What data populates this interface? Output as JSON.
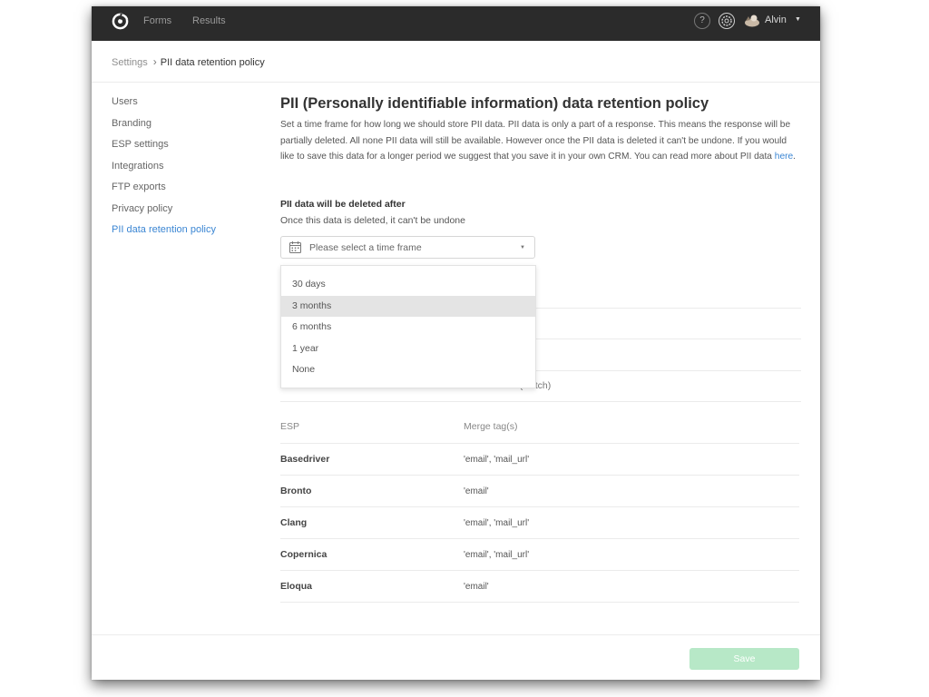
{
  "topbar": {
    "nav": [
      {
        "label": "Forms"
      },
      {
        "label": "Results"
      }
    ],
    "help_label": "?",
    "user_name": "Alvin",
    "user_caret": "▼"
  },
  "breadcrumb": {
    "parent": "Settings",
    "separator": "›",
    "current": "PII data retention policy"
  },
  "sidebar": {
    "items": [
      {
        "label": "Users"
      },
      {
        "label": "Branding"
      },
      {
        "label": "ESP settings"
      },
      {
        "label": "Integrations"
      },
      {
        "label": "FTP exports"
      },
      {
        "label": "Privacy policy"
      },
      {
        "label": "PII data retention policy",
        "active": true
      }
    ]
  },
  "main": {
    "title": "PII (Personally identifiable information) data retention policy",
    "description": "Set a time frame for how long we should store PII data. PII data is only a part of a response. This means the response will be partially deleted. All none PII data will still be available. However once the PII data is deleted it can't be undone. If you would like to save this data for a longer period we suggest that you save it in your own CRM. You can read more about PII data ",
    "description_link": "here",
    "description_end": ".",
    "section_label": "PII data will be deleted after",
    "section_sub": "Once this data is deleted, it can't be undone",
    "select": {
      "placeholder": "Please select a time frame",
      "caret": "▼",
      "options": [
        "30 days",
        "3 months",
        "6 months",
        "1 year",
        "None"
      ],
      "highlighted_index": 1
    },
    "partial_row_text": "Postal code (Dutch)"
  },
  "esp_table": {
    "headers": [
      "ESP",
      "Merge tag(s)"
    ],
    "rows": [
      {
        "esp": "Basedriver",
        "tags": "'email', 'mail_url'"
      },
      {
        "esp": "Bronto",
        "tags": "'email'"
      },
      {
        "esp": "Clang",
        "tags": "'email', 'mail_url'"
      },
      {
        "esp": "Copernica",
        "tags": "'email', 'mail_url'"
      },
      {
        "esp": "Eloqua",
        "tags": "'email'"
      }
    ]
  },
  "footer": {
    "save_label": "Save"
  },
  "colors": {
    "topbar": "#2b2b2b",
    "link": "#3b86d3",
    "save_disabled": "#b7e8c7",
    "highlight": "#e4e4e4"
  }
}
